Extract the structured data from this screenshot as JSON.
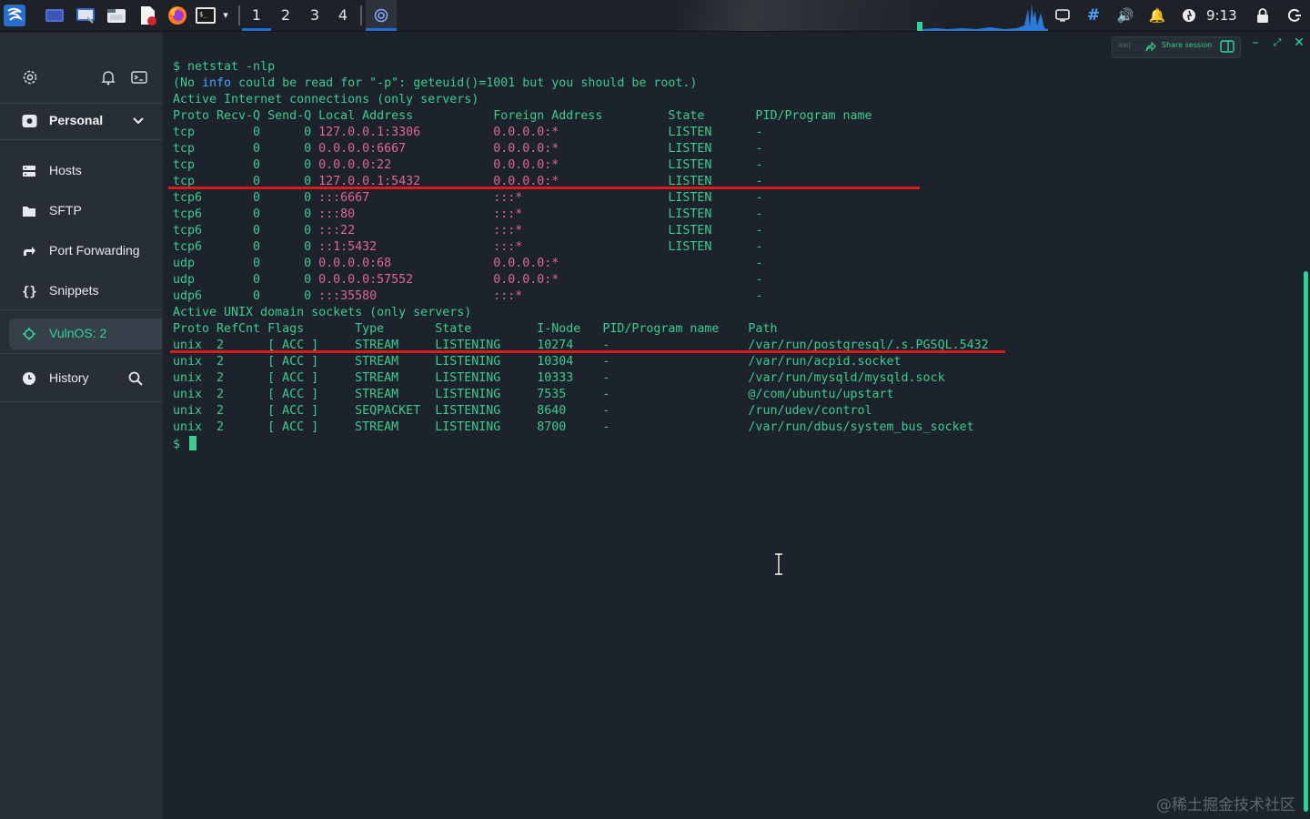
{
  "taskbar": {
    "workspaces": [
      "1",
      "2",
      "3",
      "4"
    ],
    "active_workspace": "1",
    "clock": "9:13",
    "apps": [
      "start-menu-icon",
      "desktop-icon",
      "screenshot-icon",
      "file-manager-icon",
      "text-editor-icon",
      "firefox-icon",
      "terminal-icon",
      "dropdown-icon",
      "termius-icon"
    ],
    "tray": [
      "display-icon",
      "input-method-icon",
      "volume-icon",
      "notification-icon",
      "update-icon",
      "lock-icon",
      "power-icon"
    ],
    "accent": "#1d6fd6"
  },
  "sidebar": {
    "group": "Personal",
    "items": [
      {
        "label": "Hosts",
        "icon": "hosts-icon"
      },
      {
        "label": "SFTP",
        "icon": "folder-icon"
      },
      {
        "label": "Port Forwarding",
        "icon": "port-forwarding-icon"
      },
      {
        "label": "Snippets",
        "icon": "braces-icon"
      }
    ],
    "active_host": "VulnOS: 2",
    "history": "History",
    "accent": "#2fd39a"
  },
  "terminal": {
    "toolbar": {
      "aw": "aw|",
      "share": "Share session"
    },
    "lines": [
      {
        "cls": "c-green",
        "text": "$ netstat -nlp"
      },
      {
        "cls": "",
        "parts": [
          {
            "cls": "c-green",
            "text": "(No "
          },
          {
            "cls": "c-blue",
            "text": "info"
          },
          {
            "cls": "c-green",
            "text": " could be read for \"-p\": geteuid()=1001 but you should be root.)"
          }
        ]
      },
      {
        "cls": "c-green",
        "text": "Active Internet connections (only servers)"
      },
      {
        "cls": "c-green",
        "text": "Proto Recv-Q Send-Q Local Address           Foreign Address         State       PID/Program name"
      },
      {
        "cls": "",
        "parts": [
          {
            "cls": "c-green",
            "text": "tcp        0      0 "
          },
          {
            "cls": "c-pink",
            "text": "127.0.0.1:3306          0.0.0.0:*"
          },
          {
            "cls": "c-green",
            "text": "               LISTEN      -"
          }
        ]
      },
      {
        "cls": "",
        "parts": [
          {
            "cls": "c-green",
            "text": "tcp        0      0 "
          },
          {
            "cls": "c-pink",
            "text": "0.0.0.0:6667            0.0.0.0:*"
          },
          {
            "cls": "c-green",
            "text": "               LISTEN      -"
          }
        ]
      },
      {
        "cls": "",
        "parts": [
          {
            "cls": "c-green",
            "text": "tcp        0      0 "
          },
          {
            "cls": "c-pink",
            "text": "0.0.0.0:22              0.0.0.0:*"
          },
          {
            "cls": "c-green",
            "text": "               LISTEN      -"
          }
        ]
      },
      {
        "cls": "",
        "parts": [
          {
            "cls": "c-green",
            "text": "tcp        0      0 "
          },
          {
            "cls": "c-pink",
            "text": "127.0.0.1:5432          0.0.0.0:*"
          },
          {
            "cls": "c-green",
            "text": "               LISTEN      -"
          }
        ]
      },
      {
        "cls": "",
        "parts": [
          {
            "cls": "c-green",
            "text": "tcp6       0      0 "
          },
          {
            "cls": "c-pink",
            "text": ":::6667                 :::*"
          },
          {
            "cls": "c-green",
            "text": "                    LISTEN      -"
          }
        ]
      },
      {
        "cls": "",
        "parts": [
          {
            "cls": "c-green",
            "text": "tcp6       0      0 "
          },
          {
            "cls": "c-pink",
            "text": ":::80                   :::*"
          },
          {
            "cls": "c-green",
            "text": "                    LISTEN      -"
          }
        ]
      },
      {
        "cls": "",
        "parts": [
          {
            "cls": "c-green",
            "text": "tcp6       0      0 "
          },
          {
            "cls": "c-pink",
            "text": ":::22                   :::*"
          },
          {
            "cls": "c-green",
            "text": "                    LISTEN      -"
          }
        ]
      },
      {
        "cls": "",
        "parts": [
          {
            "cls": "c-green",
            "text": "tcp6       0      0 "
          },
          {
            "cls": "c-pink",
            "text": "::1:5432                :::*"
          },
          {
            "cls": "c-green",
            "text": "                    LISTEN      -"
          }
        ]
      },
      {
        "cls": "",
        "parts": [
          {
            "cls": "c-green",
            "text": "udp        0      0 "
          },
          {
            "cls": "c-pink",
            "text": "0.0.0.0:68              0.0.0.0:*"
          },
          {
            "cls": "c-green",
            "text": "                           -"
          }
        ]
      },
      {
        "cls": "",
        "parts": [
          {
            "cls": "c-green",
            "text": "udp        0      0 "
          },
          {
            "cls": "c-pink",
            "text": "0.0.0.0:57552           0.0.0.0:*"
          },
          {
            "cls": "c-green",
            "text": "                           -"
          }
        ]
      },
      {
        "cls": "",
        "parts": [
          {
            "cls": "c-green",
            "text": "udp6       0      0 "
          },
          {
            "cls": "c-pink",
            "text": ":::35580                :::*"
          },
          {
            "cls": "c-green",
            "text": "                                -"
          }
        ]
      },
      {
        "cls": "c-green",
        "text": "Active UNIX domain sockets (only servers)"
      },
      {
        "cls": "c-green",
        "text": "Proto RefCnt Flags       Type       State         I-Node   PID/Program name    Path"
      },
      {
        "cls": "c-green",
        "text": "unix  2      [ ACC ]     STREAM     LISTENING     10274    -                   /var/run/postgresql/.s.PGSQL.5432"
      },
      {
        "cls": "c-green",
        "text": "unix  2      [ ACC ]     STREAM     LISTENING     10304    -                   /var/run/acpid.socket"
      },
      {
        "cls": "c-green",
        "text": "unix  2      [ ACC ]     STREAM     LISTENING     10333    -                   /var/run/mysqld/mysqld.sock"
      },
      {
        "cls": "c-green",
        "text": "unix  2      [ ACC ]     STREAM     LISTENING     7535     -                   @/com/ubuntu/upstart"
      },
      {
        "cls": "c-green",
        "text": "unix  2      [ ACC ]     SEQPACKET  LISTENING     8640     -                   /run/udev/control"
      },
      {
        "cls": "c-green",
        "text": "unix  2      [ ACC ]     STREAM     LISTENING     8700     -                   /var/run/dbus/system_bus_socket"
      }
    ],
    "prompt": "$ ",
    "colors": {
      "green": "#3ecb8c",
      "pink": "#e2649a",
      "blue": "#4aa2ff",
      "highlight": "#e01919"
    }
  },
  "watermark": "@稀土掘金技术社区"
}
